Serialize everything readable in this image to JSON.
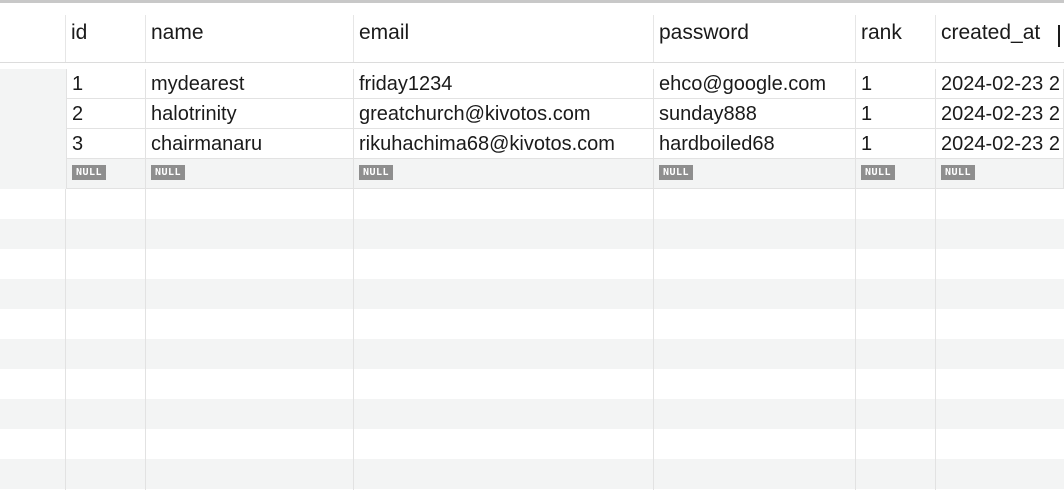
{
  "table": {
    "columns": [
      "id",
      "name",
      "email",
      "password",
      "rank",
      "created_at"
    ],
    "rows": [
      {
        "id": "1",
        "name": "mydearest",
        "email": "friday1234",
        "password": "ehco@google.com",
        "rank": "1",
        "created_at": "2024-02-23 2"
      },
      {
        "id": "2",
        "name": "halotrinity",
        "email": "greatchurch@kivotos.com",
        "password": "sunday888",
        "rank": "1",
        "created_at": "2024-02-23 2"
      },
      {
        "id": "3",
        "name": "chairmanaru",
        "email": "rikuhachima68@kivotos.com",
        "password": "hardboiled68",
        "rank": "1",
        "created_at": "2024-02-23 2"
      }
    ],
    "null_label": "NULL"
  }
}
